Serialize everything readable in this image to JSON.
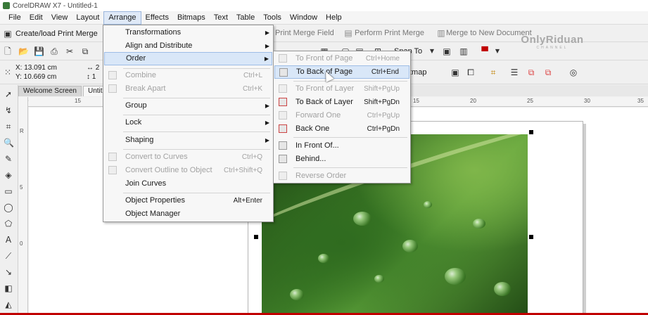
{
  "window": {
    "title": "CorelDRAW X7 - Untitled-1"
  },
  "menubar": [
    "File",
    "Edit",
    "View",
    "Layout",
    "Arrange",
    "Effects",
    "Bitmaps",
    "Text",
    "Table",
    "Tools",
    "Window",
    "Help"
  ],
  "toolbar1": {
    "create_print_merge": "Create/load Print Merge",
    "print_merge_field": "Print Merge Field",
    "perform_print_merge": "Perform Print Merge",
    "merge_to_new_document": "Merge to New Document"
  },
  "toolbar2": {
    "snap_to": "Snap To"
  },
  "toolbar3": {
    "x": "X: 13.091 cm",
    "y": "Y: 10.669 cm",
    "w_prefix": "2",
    "h_prefix": "1",
    "bitmap_label": "tmap"
  },
  "tabs": [
    "Welcome Screen",
    "Untit"
  ],
  "ruler": {
    "h_ticks": [
      "15",
      "15",
      "20",
      "25",
      "30",
      "35"
    ],
    "v_ticks": [
      "R",
      "5",
      "0"
    ]
  },
  "watermark": {
    "main": "OnlyRiduan",
    "sub": "CHANNEL"
  },
  "arrange_menu": {
    "items": [
      {
        "label": "Transformations",
        "shortcut": "",
        "submenu": true,
        "disabled": false
      },
      {
        "label": "Align and Distribute",
        "shortcut": "",
        "submenu": true,
        "disabled": false
      },
      {
        "label": "Order",
        "shortcut": "",
        "submenu": true,
        "disabled": false,
        "highlighted": true
      },
      {
        "label": "Combine",
        "shortcut": "Ctrl+L",
        "submenu": false,
        "disabled": true
      },
      {
        "label": "Break Apart",
        "shortcut": "Ctrl+K",
        "submenu": false,
        "disabled": true
      },
      {
        "label": "Group",
        "shortcut": "",
        "submenu": true,
        "disabled": false
      },
      {
        "label": "Lock",
        "shortcut": "",
        "submenu": true,
        "disabled": false
      },
      {
        "label": "Shaping",
        "shortcut": "",
        "submenu": true,
        "disabled": false
      },
      {
        "label": "Convert to Curves",
        "shortcut": "Ctrl+Q",
        "submenu": false,
        "disabled": true
      },
      {
        "label": "Convert Outline to Object",
        "shortcut": "Ctrl+Shift+Q",
        "submenu": false,
        "disabled": true
      },
      {
        "label": "Join Curves",
        "shortcut": "",
        "submenu": false,
        "disabled": false
      },
      {
        "label": "Object Properties",
        "shortcut": "Alt+Enter",
        "submenu": false,
        "disabled": false
      },
      {
        "label": "Object Manager",
        "shortcut": "",
        "submenu": false,
        "disabled": false
      }
    ]
  },
  "order_menu": {
    "items": [
      {
        "label": "To Front of Page",
        "shortcut": "Ctrl+Home",
        "disabled": true
      },
      {
        "label": "To Back of Page",
        "shortcut": "Ctrl+End",
        "disabled": false,
        "highlighted": true
      },
      {
        "label": "To Front of Layer",
        "shortcut": "Shift+PgUp",
        "disabled": true
      },
      {
        "label": "To Back of Layer",
        "shortcut": "Shift+PgDn",
        "disabled": false
      },
      {
        "label": "Forward One",
        "shortcut": "Ctrl+PgUp",
        "disabled": true
      },
      {
        "label": "Back One",
        "shortcut": "Ctrl+PgDn",
        "disabled": false
      },
      {
        "label": "In Front Of...",
        "shortcut": "",
        "disabled": false
      },
      {
        "label": "Behind...",
        "shortcut": "",
        "disabled": false
      },
      {
        "label": "Reverse Order",
        "shortcut": "",
        "disabled": true
      }
    ]
  },
  "colors": {
    "menu_highlight": "#d9e7f8",
    "accent_red": "#c00000"
  }
}
